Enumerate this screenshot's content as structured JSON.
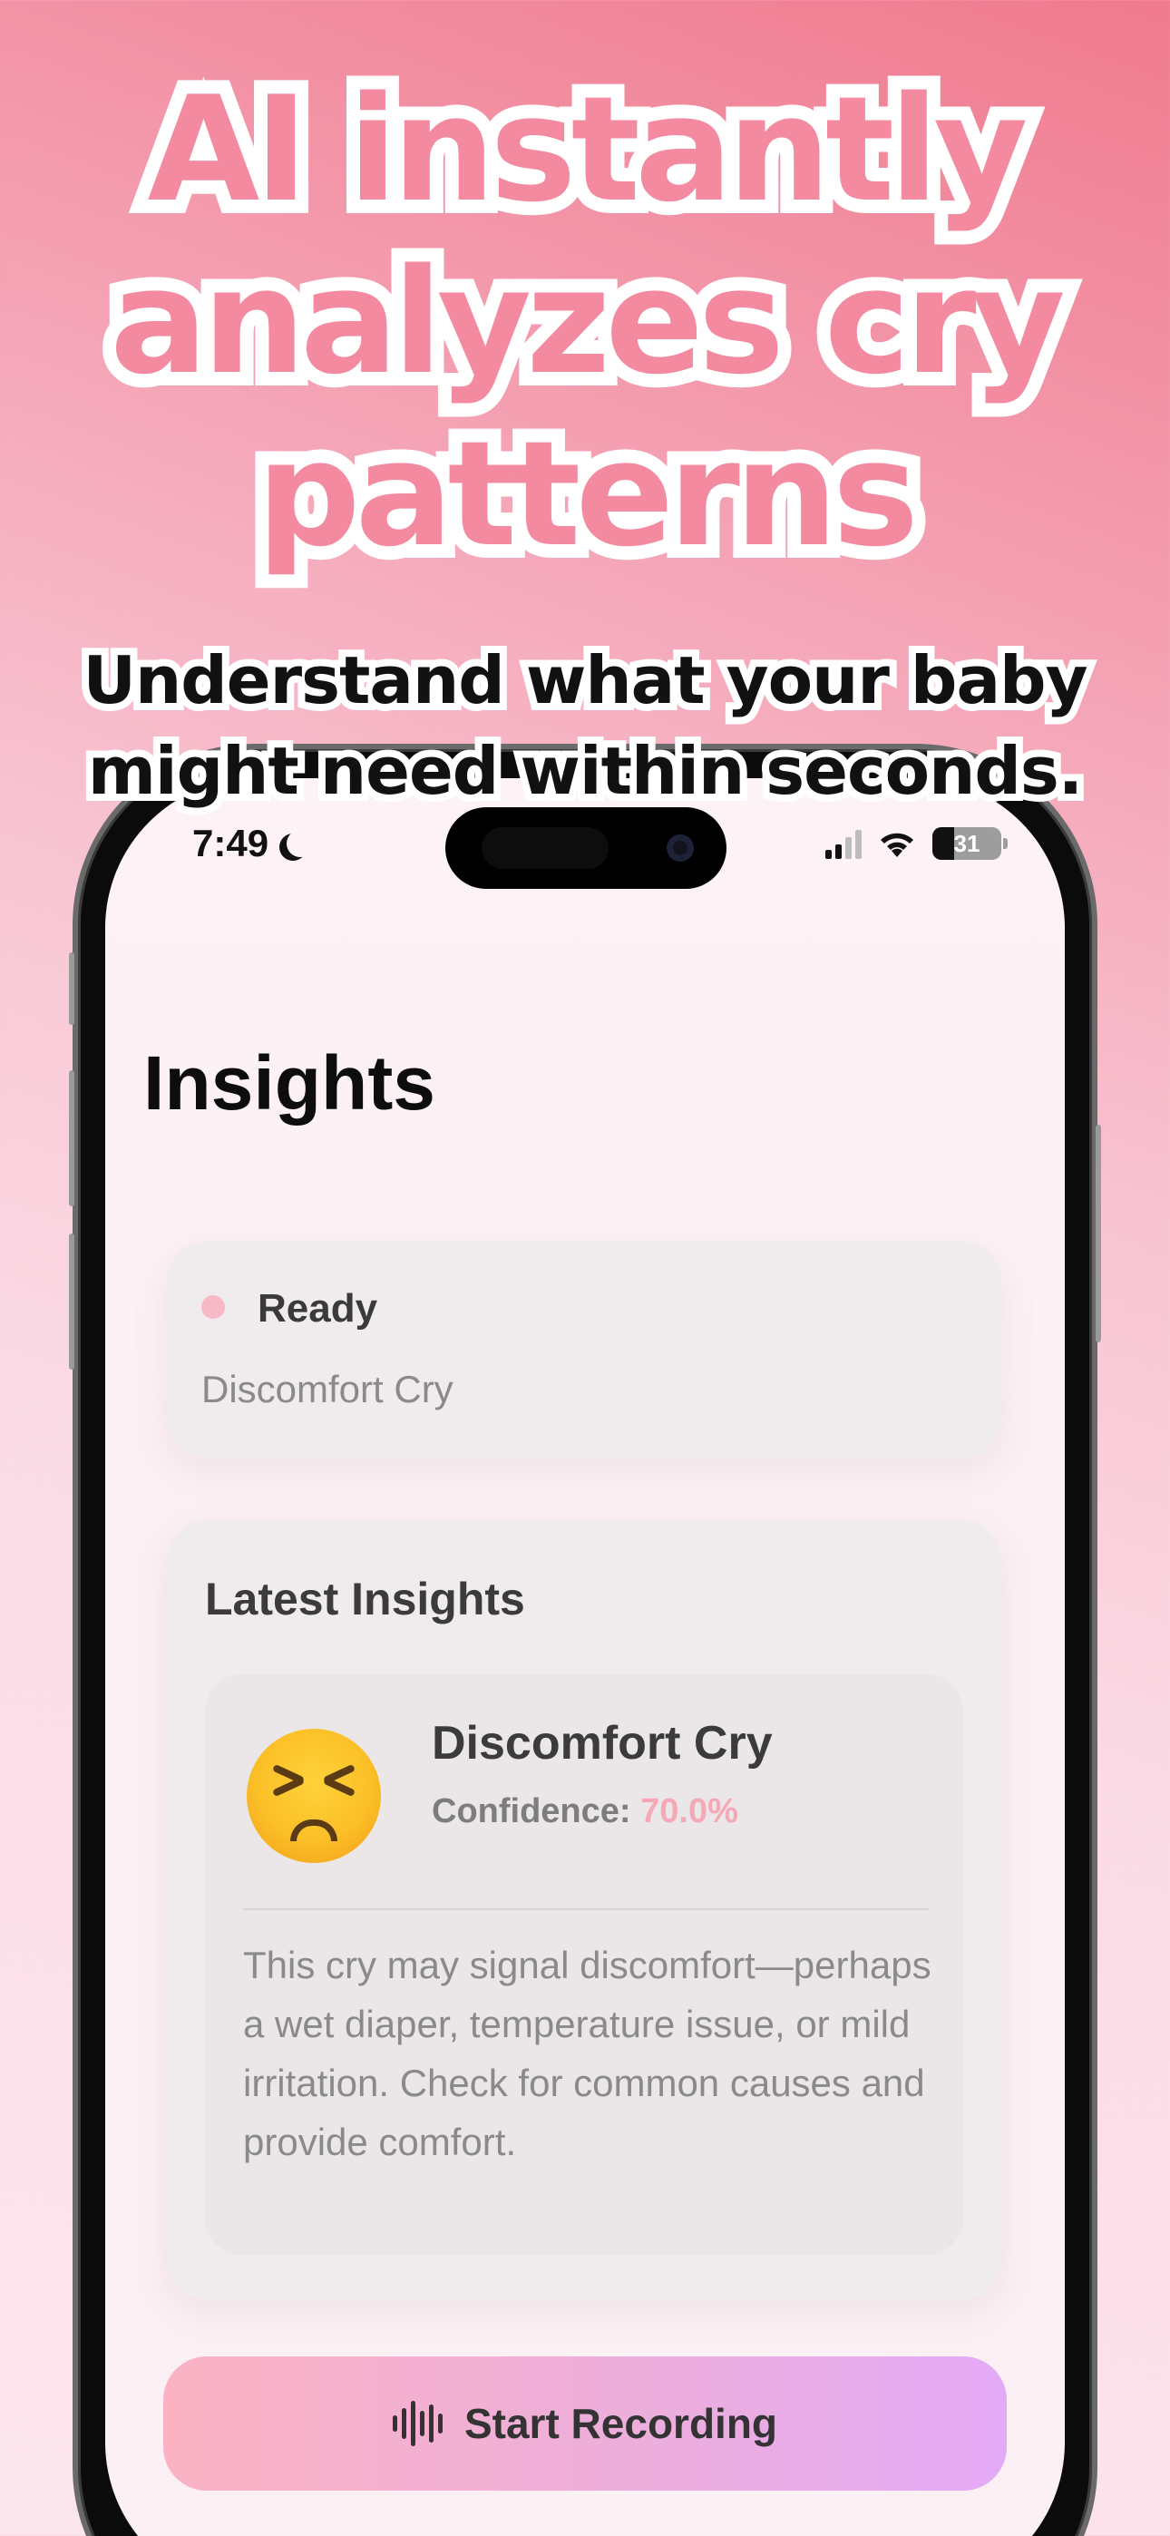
{
  "promo": {
    "headline": "AI instantly analyzes cry patterns",
    "subheadline": "Understand what your baby might need within seconds."
  },
  "status_bar": {
    "time": "7:49",
    "battery": "31",
    "icons": [
      "moon-icon",
      "signal-icon",
      "wifi-icon",
      "battery-icon"
    ]
  },
  "page": {
    "title": "Insights"
  },
  "status_card": {
    "label": "Ready",
    "subtitle": "Discomfort Cry"
  },
  "insights": {
    "title": "Latest Insights",
    "item": {
      "emoji_icon": "persevering-face-icon",
      "name": "Discomfort Cry",
      "confidence_label": "Confidence:",
      "confidence_value": "70.0%",
      "description": "This cry may signal discomfort—perhaps a wet diaper, temperature issue, or mild irritation. Check for common causes and provide comfort."
    }
  },
  "action": {
    "record_label": "Start Recording",
    "icon": "waveform-icon"
  },
  "colors": {
    "accent_pink": "#f7a8b7",
    "headline_pink": "#f48aa0",
    "button_gradient_start": "#fbb3c3",
    "button_gradient_end": "#e3aaf6"
  }
}
